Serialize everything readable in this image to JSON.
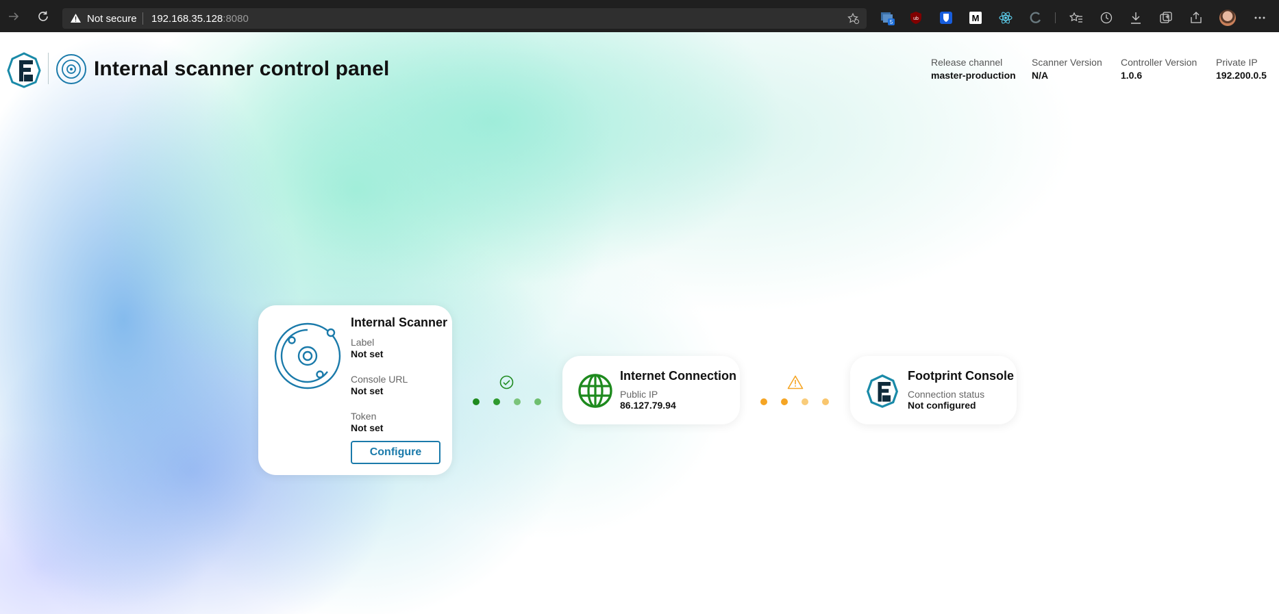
{
  "browser": {
    "security_label": "Not secure",
    "url_host": "192.168.35.128",
    "url_port": ":8080",
    "extension_badge": "5",
    "extension_m_label": "M"
  },
  "header": {
    "title": "Internal scanner control panel",
    "info": [
      {
        "label": "Release channel",
        "value": "master-production"
      },
      {
        "label": "Scanner Version",
        "value": "N/A"
      },
      {
        "label": "Controller Version",
        "value": "1.0.6"
      },
      {
        "label": "Private IP",
        "value": "192.200.0.5"
      }
    ]
  },
  "scanner_card": {
    "title": "Internal Scanner",
    "fields": [
      {
        "label": "Label",
        "value": "Not set"
      },
      {
        "label": "Console URL",
        "value": "Not set"
      },
      {
        "label": "Token",
        "value": "Not set"
      }
    ],
    "button_label": "Configure"
  },
  "internet_card": {
    "title": "Internet Connection",
    "label": "Public IP",
    "value": "86.127.79.94"
  },
  "console_card": {
    "title": "Footprint Console",
    "label": "Connection status",
    "value": "Not configured"
  },
  "connections": {
    "scanner_to_internet": {
      "status": "ok",
      "color": "#1e8a1e"
    },
    "internet_to_console": {
      "status": "warning",
      "color": "#f5a524"
    }
  },
  "colors": {
    "brand_teal": "#1a7aaa",
    "ok_green": "#1e8a1e",
    "warning_orange": "#f5a524"
  }
}
